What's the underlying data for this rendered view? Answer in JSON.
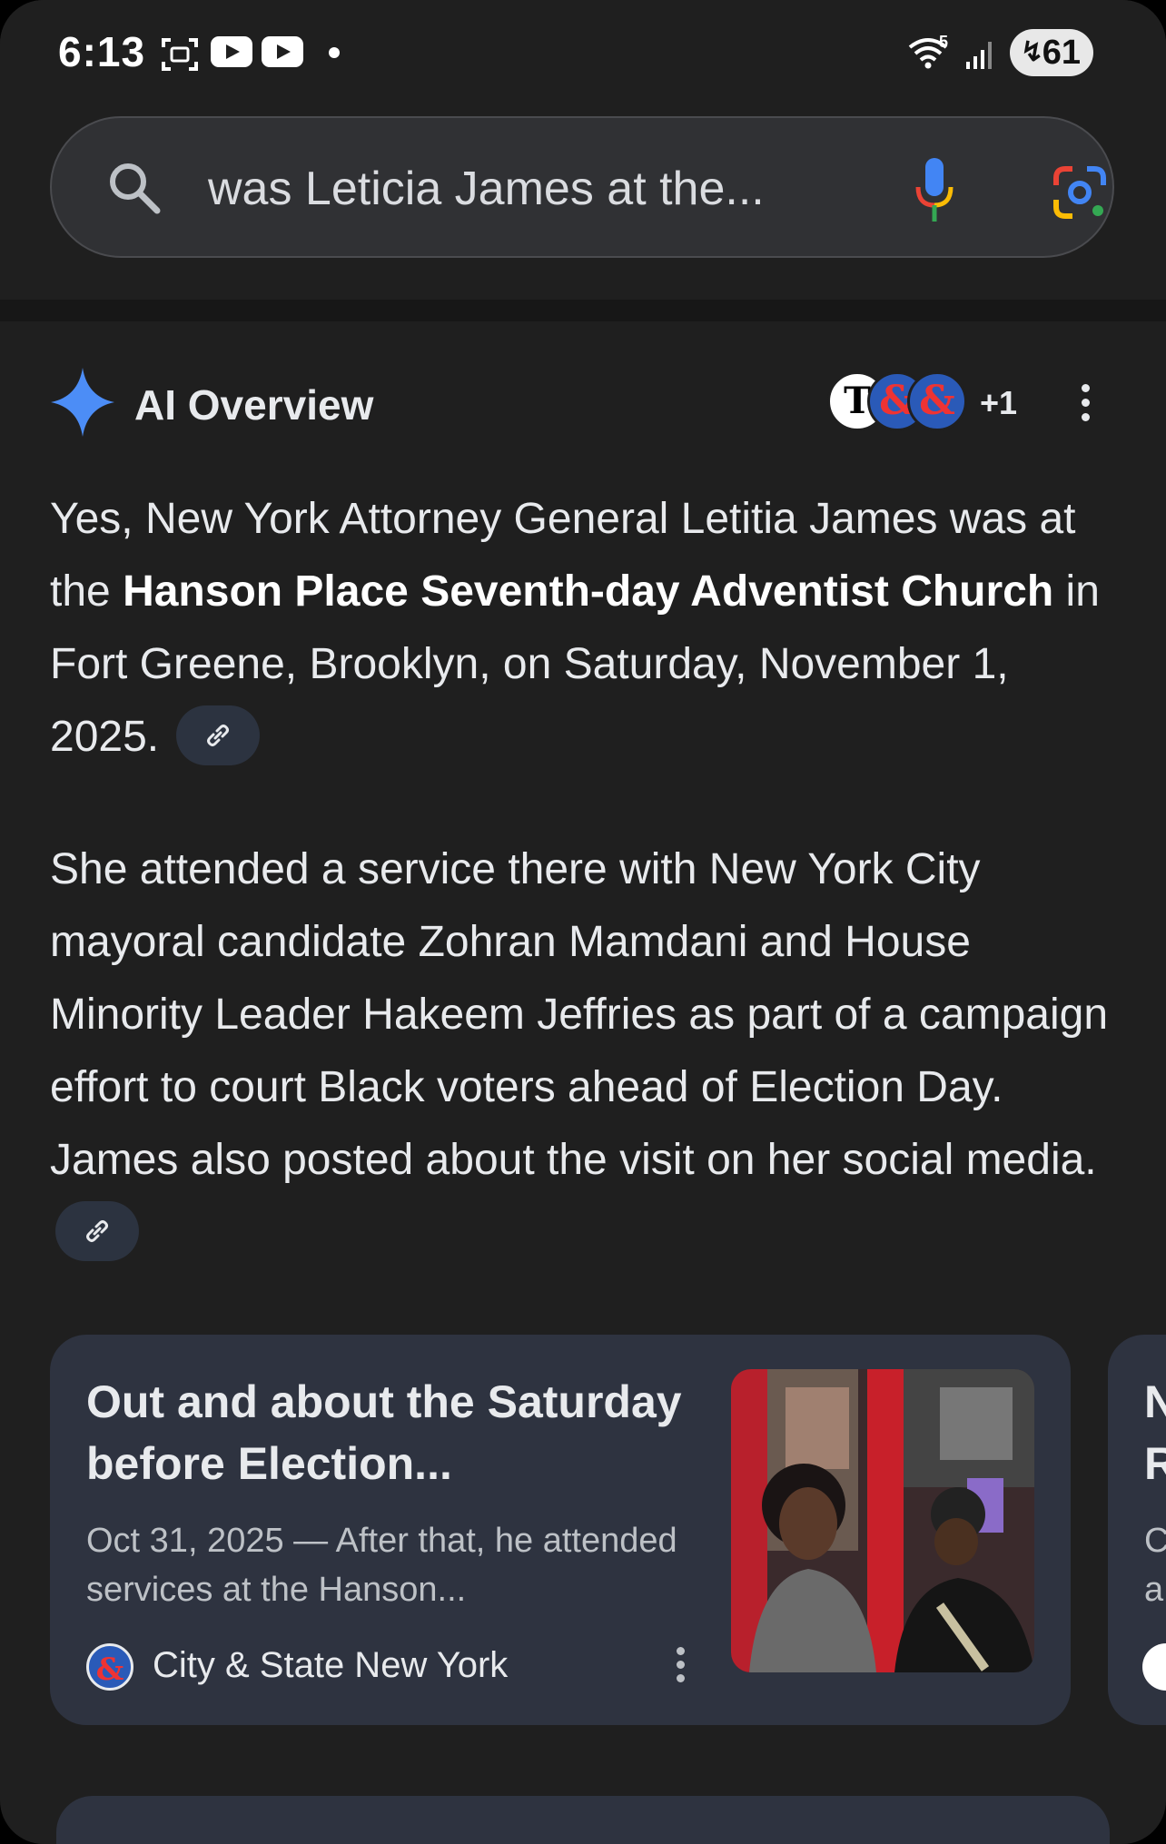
{
  "status_bar": {
    "time": "6:13",
    "wifi_label": "5",
    "battery": "61",
    "icons": [
      "screen-record-icon",
      "youtube-icon",
      "youtube-icon",
      "notification-dot",
      "wifi-icon",
      "signal-icon",
      "battery-icon"
    ]
  },
  "search": {
    "query": "was Leticia James at the...",
    "icons": [
      "search-icon",
      "mic-icon",
      "google-lens-icon"
    ]
  },
  "ai_overview": {
    "title": "AI Overview",
    "sources": [
      {
        "initial": "T"
      },
      {
        "initial": "&"
      },
      {
        "initial": "&"
      }
    ],
    "more_sources": "+1",
    "paragraph1": {
      "text_a": "Yes, New York Attorney General Letitia James was at the ",
      "bold": "Hanson Place Seventh-day Adventist Church",
      "text_b": " in Fort Greene, Brooklyn, on Saturday, November 1, 2025."
    },
    "paragraph2": "She attended a service there with New York City mayoral candidate Zohran Mamdani and House Minority Leader Hakeem Jeffries as part of a campaign effort to court Black voters ahead of Election Day. James also posted about the visit on her social media."
  },
  "cards": [
    {
      "title": "Out and about the Saturday before Election...",
      "snippet": "Oct 31, 2025 — After that, he attended services at the Hanson...",
      "site": "City & State New York",
      "site_initial": "&"
    },
    {
      "title": "N\nR",
      "snippet": "C\na"
    }
  ],
  "colors": {
    "background": "#1f1f1f",
    "card": "#2e3340",
    "search_bar": "#303134",
    "sparkle": "#4c8df6"
  }
}
